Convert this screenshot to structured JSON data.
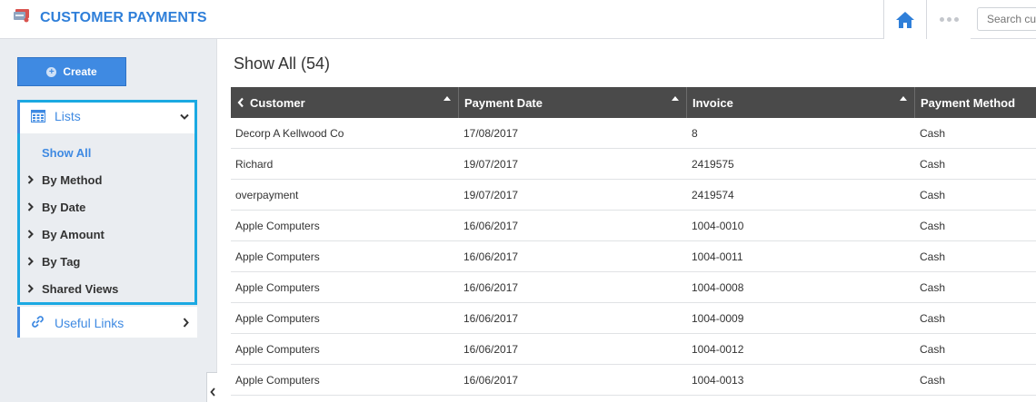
{
  "header": {
    "title": "CUSTOMER PAYMENTS",
    "search_placeholder": "Search cu",
    "accent_color": "#2f7fd9"
  },
  "sidebar": {
    "create_label": "Create",
    "lists_label": "Lists",
    "list_items": [
      {
        "label": "Show All",
        "active": true
      },
      {
        "label": "By Method",
        "active": false
      },
      {
        "label": "By Date",
        "active": false
      },
      {
        "label": "By Amount",
        "active": false
      },
      {
        "label": "By Tag",
        "active": false
      },
      {
        "label": "Shared Views",
        "active": false
      }
    ],
    "useful_links_label": "Useful Links",
    "highlight_color": "#1ba9e2"
  },
  "main": {
    "title": "Show All (54)",
    "columns": [
      "Customer",
      "Payment Date",
      "Invoice",
      "Payment Method"
    ],
    "rows": [
      [
        "Decorp A Kellwood Co",
        "17/08/2017",
        "8",
        "Cash"
      ],
      [
        "Richard",
        "19/07/2017",
        "2419575",
        "Cash"
      ],
      [
        "overpayment",
        "19/07/2017",
        "2419574",
        "Cash"
      ],
      [
        "Apple Computers",
        "16/06/2017",
        "1004-0010",
        "Cash"
      ],
      [
        "Apple Computers",
        "16/06/2017",
        "1004-0011",
        "Cash"
      ],
      [
        "Apple Computers",
        "16/06/2017",
        "1004-0008",
        "Cash"
      ],
      [
        "Apple Computers",
        "16/06/2017",
        "1004-0009",
        "Cash"
      ],
      [
        "Apple Computers",
        "16/06/2017",
        "1004-0012",
        "Cash"
      ],
      [
        "Apple Computers",
        "16/06/2017",
        "1004-0013",
        "Cash"
      ]
    ]
  }
}
